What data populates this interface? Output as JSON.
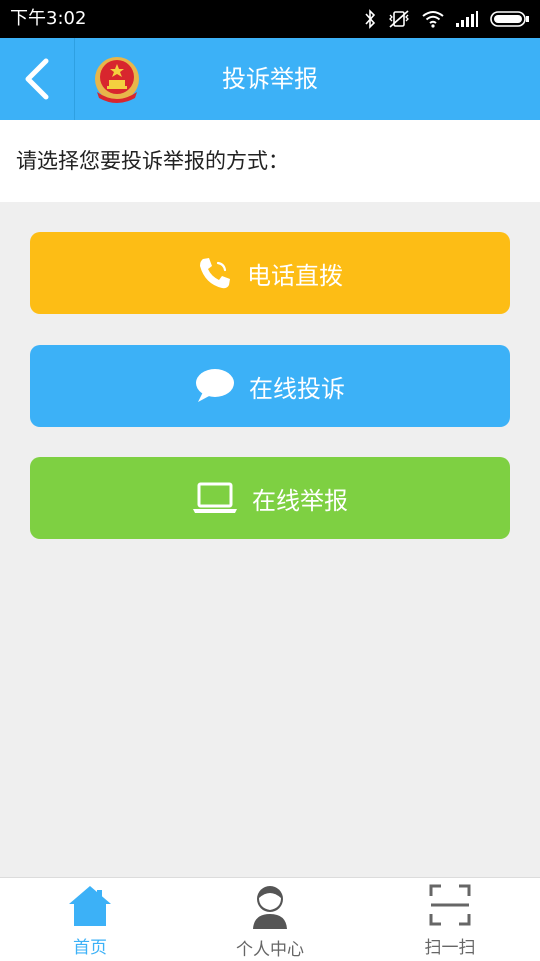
{
  "status_bar": {
    "time": "下午3:02"
  },
  "header": {
    "title": "投诉举报"
  },
  "prompt": {
    "text": "请选择您要投诉举报的方式："
  },
  "actions": [
    {
      "label": "电话直拨",
      "icon": "phone-icon",
      "color": "#fdbd15"
    },
    {
      "label": "在线投诉",
      "icon": "chat-bubble-icon",
      "color": "#3cb1f7"
    },
    {
      "label": "在线举报",
      "icon": "laptop-icon",
      "color": "#7ed042"
    }
  ],
  "tabs": [
    {
      "label": "首页",
      "icon": "home-icon",
      "active": true,
      "color": "#3cb1f7"
    },
    {
      "label": "个人中心",
      "icon": "user-icon",
      "active": false,
      "color": "#666666"
    },
    {
      "label": "扫一扫",
      "icon": "scan-icon",
      "active": false,
      "color": "#666666"
    }
  ],
  "colors": {
    "header": "#3cb1f7",
    "background": "#efefef"
  }
}
